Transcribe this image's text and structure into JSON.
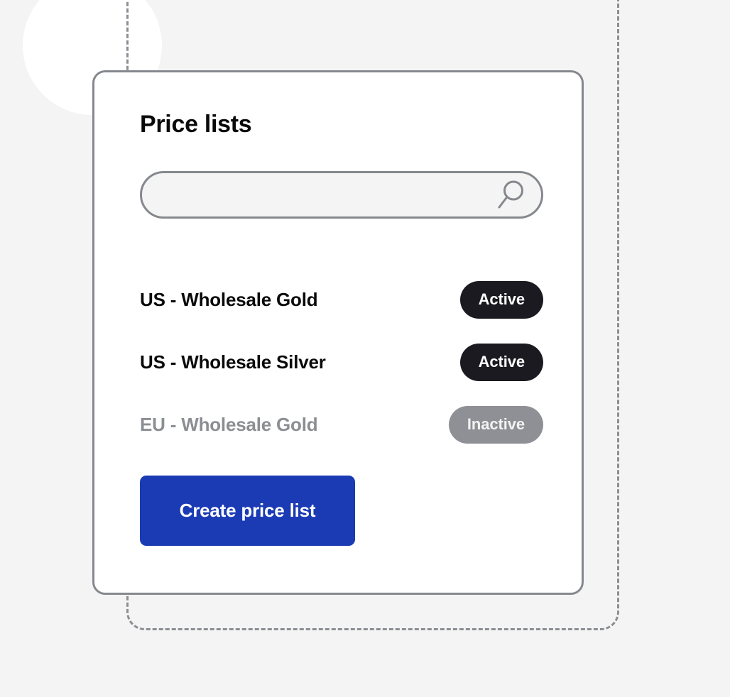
{
  "theme": {
    "background": "#f4f4f4",
    "card_background": "#ffffff",
    "card_border": "#85888d",
    "accent": "#1b3bb5",
    "badge_active_bg": "#1a1a20",
    "badge_inactive_bg": "#8e9095",
    "muted_text": "#8b8e93",
    "dashed_outline": "#8b8e93"
  },
  "card": {
    "title": "Price lists"
  },
  "search": {
    "value": "",
    "placeholder": "",
    "icon": "search-icon"
  },
  "price_lists": [
    {
      "name": "US - Wholesale Gold",
      "status": "Active",
      "state": "active"
    },
    {
      "name": "US - Wholesale Silver",
      "status": "Active",
      "state": "active"
    },
    {
      "name": "EU - Wholesale Gold",
      "status": "Inactive",
      "state": "inactive"
    }
  ],
  "actions": {
    "create_label": "Create price list"
  },
  "decor": {
    "circle": "white-circle",
    "frame": "dashed-outline-frame"
  }
}
